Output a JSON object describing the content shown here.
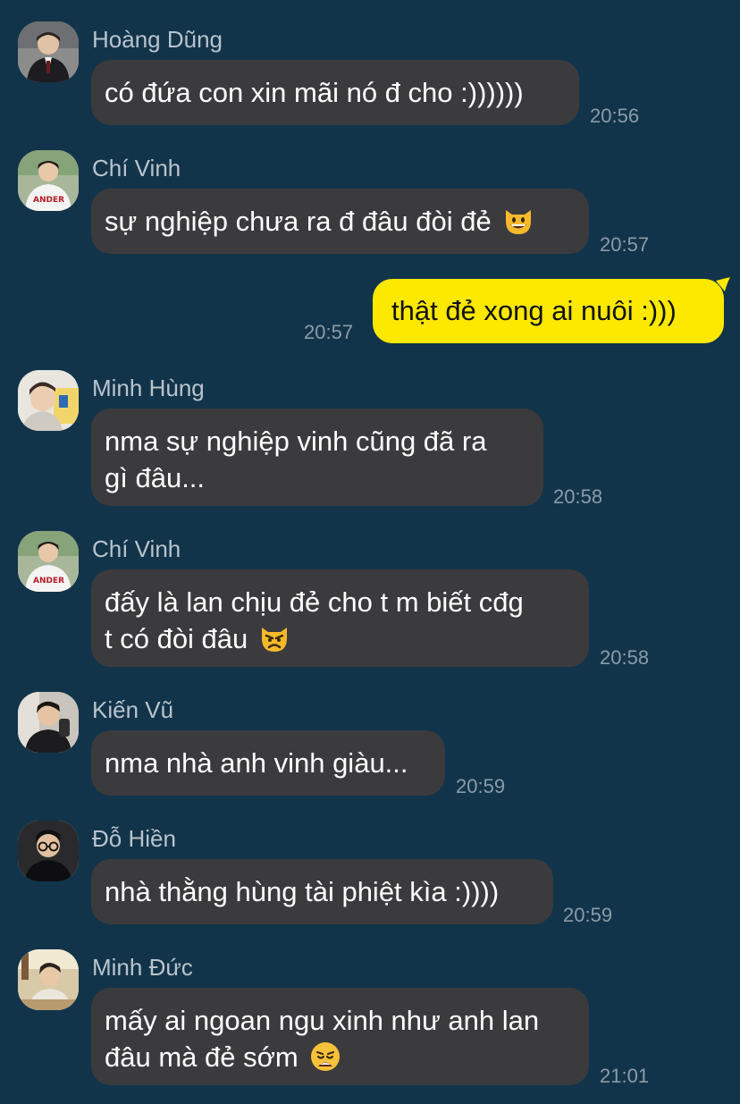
{
  "colors": {
    "background": "#12344a",
    "incoming_bubble": "#3b3b3d",
    "outgoing_bubble": "#fde800",
    "sender_name": "#b9c3cc",
    "timestamp": "#8a9ba8"
  },
  "messages": [
    {
      "sender": "Hoàng Dũng",
      "lines": [
        "có đứa con xin mãi nó đ cho :))))))"
      ],
      "time": "20:56",
      "avatar": "avatar-suit-photo"
    },
    {
      "sender": "Chí Vinh",
      "lines": [
        "sự nghiệp chưa ra đ đâu đòi đẻ"
      ],
      "emoji": "grinning-cat-emoji",
      "time": "20:57",
      "avatar": "avatar-baseball-jersey-photo"
    },
    {
      "sender": "",
      "lines": [
        "thật đẻ xong ai nuôi :)))"
      ],
      "time": "20:57",
      "outgoing": true
    },
    {
      "sender": "Minh Hùng",
      "lines": [
        "nma sự nghiệp vinh cũng đã ra",
        "gì đâu..."
      ],
      "time": "20:58",
      "avatar": "avatar-selfie-photo"
    },
    {
      "sender": "Chí Vinh",
      "lines": [
        "đấy là lan chịu đẻ cho t m biết cđg",
        "t có đòi đâu"
      ],
      "emoji": "pouting-cat-emoji",
      "time": "20:58",
      "avatar": "avatar-baseball-jersey-photo"
    },
    {
      "sender": "Kiến Vũ",
      "lines": [
        "nma nhà anh vinh giàu..."
      ],
      "time": "20:59",
      "avatar": "avatar-mirror-selfie-photo"
    },
    {
      "sender": "Đỗ Hiền",
      "lines": [
        "nhà thằng hùng tài phiệt kìa :))))"
      ],
      "time": "20:59",
      "avatar": "avatar-glasses-photo"
    },
    {
      "sender": "Minh Đức",
      "lines": [
        "mấy ai ngoan ngu xinh như anh lan",
        "đâu mà đẻ sớm"
      ],
      "emoji": "weary-face-emoji",
      "time": "21:01",
      "avatar": "avatar-cafe-photo"
    }
  ]
}
